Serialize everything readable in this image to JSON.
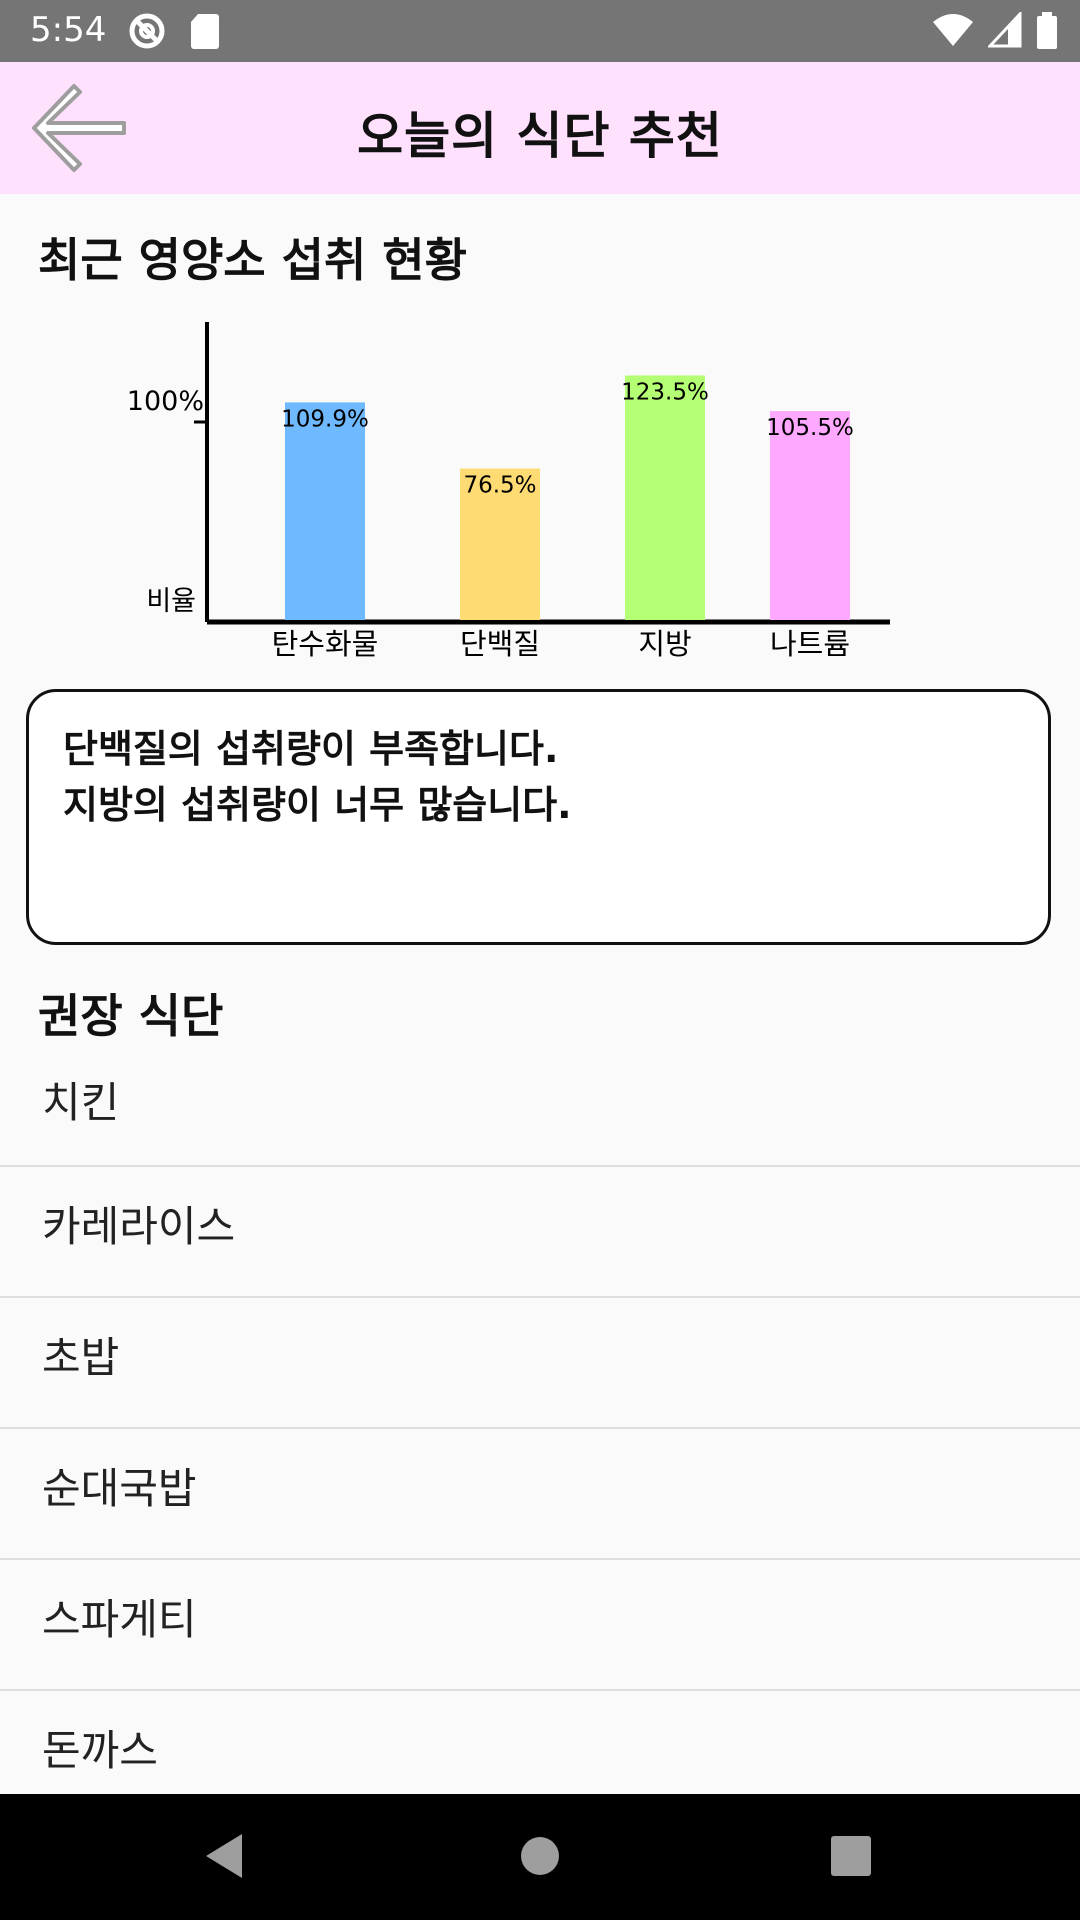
{
  "status": {
    "time": "5:54"
  },
  "appbar": {
    "title": "오늘의 식단 추천"
  },
  "nutrition": {
    "section_title": "최근 영양소 섭취 현황"
  },
  "chart_data": {
    "type": "bar",
    "title": "",
    "categories": [
      "탄수화물",
      "단백질",
      "지방",
      "나트륨"
    ],
    "values": [
      109.9,
      76.5,
      123.5,
      105.5
    ],
    "value_labels": [
      "109.9%",
      "76.5%",
      "123.5%",
      "105.5%"
    ],
    "colors": [
      "#6eb9ff",
      "#ffdb73",
      "#b4ff73",
      "#ffa8ff"
    ],
    "ylabel": "비율",
    "y_tick_label": "100%",
    "y_tick_value": 100,
    "ylim": [
      0,
      135
    ]
  },
  "message": {
    "lines": [
      "단백질의 섭취량이 부족합니다.",
      "지방의 섭취량이 너무 많습니다."
    ]
  },
  "recommend": {
    "section_title": "권장 식단",
    "items": [
      "치킨",
      "카레라이스",
      "초밥",
      "순대국밥",
      "스파게티",
      "돈까스"
    ]
  }
}
